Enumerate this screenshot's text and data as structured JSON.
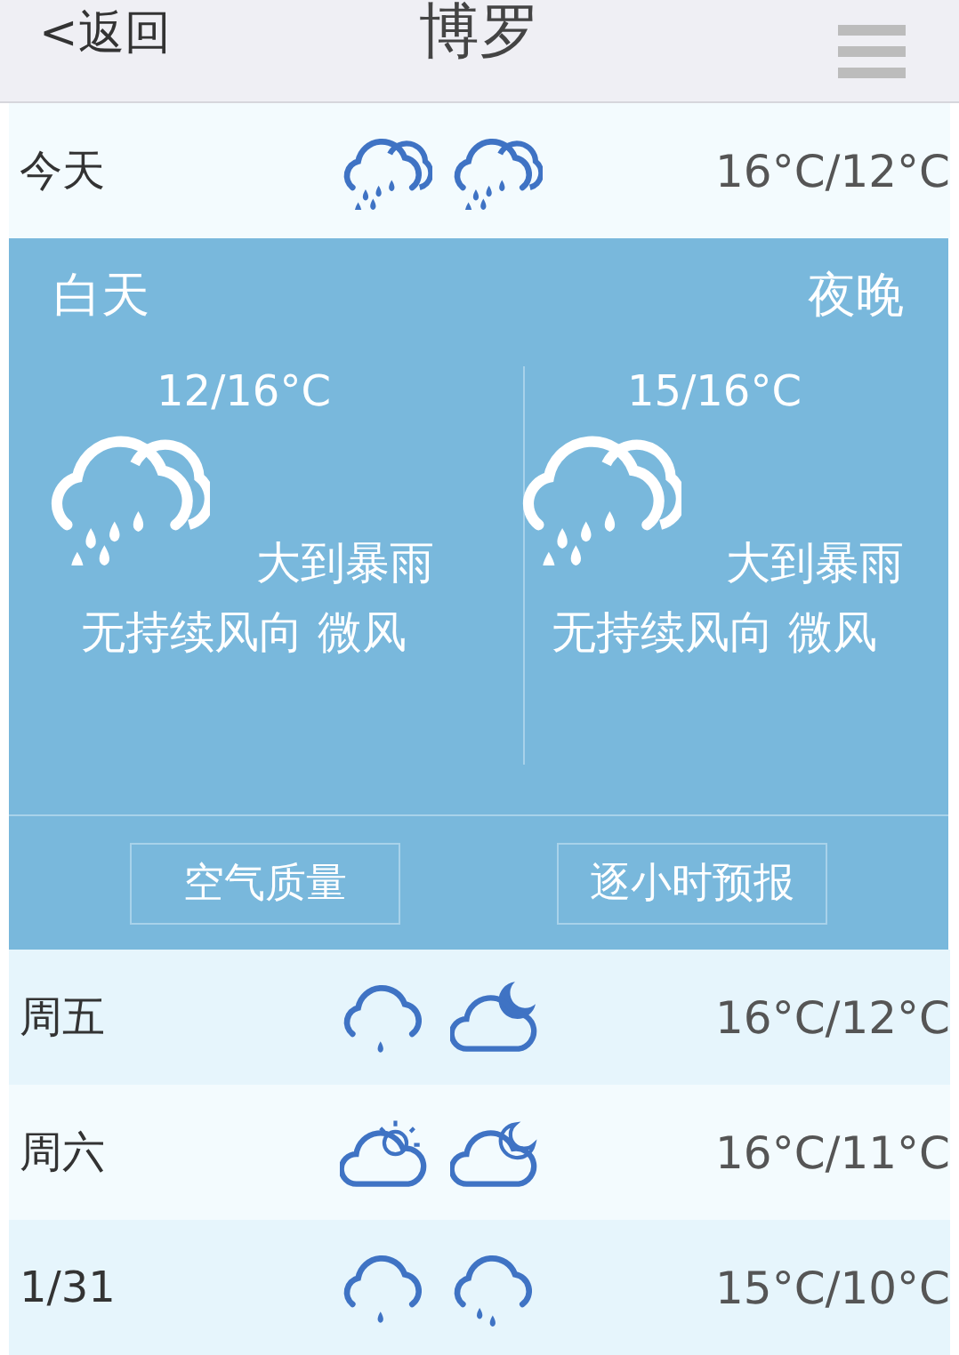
{
  "header": {
    "back": "<返回",
    "title": "博罗"
  },
  "today": {
    "label": "今天",
    "icons": [
      {
        "kind": "rain-heavy"
      },
      {
        "kind": "rain-heavy"
      }
    ],
    "temp": "16°C/12°C"
  },
  "detail": {
    "periods": [
      {
        "label": "白天",
        "temp": "12/16°C",
        "icon": {
          "kind": "rain-heavy"
        },
        "weather": "大到暴雨",
        "wind": "无持续风向 微风"
      },
      {
        "label": "夜晚",
        "temp": "15/16°C",
        "icon": {
          "kind": "rain-heavy"
        },
        "weather": "大到暴雨",
        "wind": "无持续风向 微风"
      }
    ],
    "buttons": [
      "空气质量",
      "逐小时预报"
    ]
  },
  "days": [
    {
      "label": "周五",
      "icons": [
        {
          "kind": "rain-light"
        },
        {
          "kind": "cloud-moon-filled"
        }
      ],
      "temp": "16°C/12°C"
    },
    {
      "label": "周六",
      "icons": [
        {
          "kind": "cloud-sun"
        },
        {
          "kind": "cloud-moon"
        }
      ],
      "temp": "16°C/11°C"
    },
    {
      "label": "1/31",
      "icons": [
        {
          "kind": "rain-light"
        },
        {
          "kind": "rain-moderate"
        }
      ],
      "temp": "15°C/10°C"
    }
  ]
}
